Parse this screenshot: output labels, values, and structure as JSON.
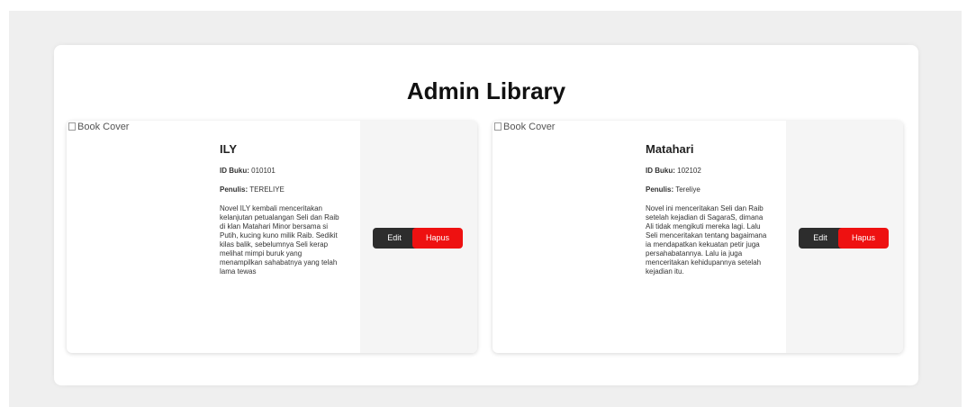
{
  "page": {
    "title": "Admin Library"
  },
  "books": [
    {
      "cover_alt": "Book Cover",
      "title": "ILY",
      "id_label": "ID Buku:",
      "id_value": "010101",
      "author_label": "Penulis:",
      "author_value": "TERELIYE",
      "description": "Novel ILY kembali menceritakan kelanjutan petualangan Seli dan Raib di klan Matahari Minor bersama si Putih, kucing kuno milik Raib. Sedikit kilas balik, sebelumnya Seli kerap melihat mimpi buruk yang menampilkan sahabatnya yang telah lama tewas",
      "edit_label": "Edit",
      "delete_label": "Hapus"
    },
    {
      "cover_alt": "Book Cover",
      "title": "Matahari",
      "id_label": "ID Buku:",
      "id_value": "102102",
      "author_label": "Penulis:",
      "author_value": "Tereliye",
      "description": "Novel ini menceritakan Seli dan Raib setelah kejadian di SagaraS, dimana Ali tidak mengikuti mereka lagi. Lalu Seli menceritakan tentang bagaimana ia mendapatkan kekuatan petir juga persahabatannya. Lalu ia juga menceritakan kehidupannya setelah kejadian itu.",
      "edit_label": "Edit",
      "delete_label": "Hapus"
    }
  ],
  "colors": {
    "background": "#efefef",
    "panel": "#ffffff",
    "edit_button": "#2d2d2d",
    "delete_button": "#ee1111",
    "actions_bg": "#f5f5f5"
  }
}
